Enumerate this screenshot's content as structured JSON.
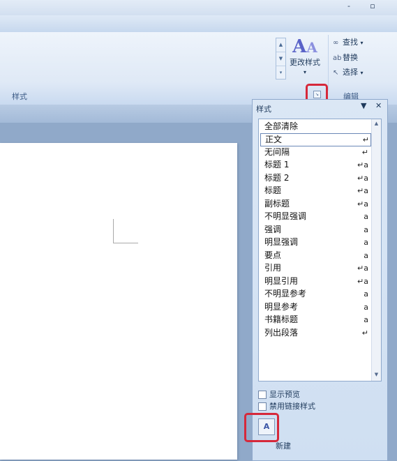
{
  "window": {
    "minimize_glyph": "-",
    "restore_glyph": "▫"
  },
  "ribbon": {
    "styles_group_label": "样式",
    "editing_group_label": "编辑",
    "change_styles_label": "更改样式",
    "change_styles_arrow": "▾",
    "find_label": "查找",
    "replace_label": "替换",
    "select_label": "选择",
    "launcher_icon": "dialog-launcher-icon",
    "scroll_glyphs": [
      "▲",
      "▼",
      "▾"
    ]
  },
  "styles_pane": {
    "title": "样式",
    "menu_glyph": "▼",
    "close_glyph": "✕",
    "items": [
      {
        "label": "全部清除",
        "symbol": ""
      },
      {
        "label": "正文",
        "symbol": "↵"
      },
      {
        "label": "无间隔",
        "symbol": "↵"
      },
      {
        "label": "标题 1",
        "symbol": "↵a"
      },
      {
        "label": "标题 2",
        "symbol": "↵a"
      },
      {
        "label": "标题",
        "symbol": "↵a"
      },
      {
        "label": "副标题",
        "symbol": "↵a"
      },
      {
        "label": "不明显强调",
        "symbol": "a"
      },
      {
        "label": "强调",
        "symbol": "a"
      },
      {
        "label": "明显强调",
        "symbol": "a"
      },
      {
        "label": "要点",
        "symbol": "a"
      },
      {
        "label": "引用",
        "symbol": "↵a"
      },
      {
        "label": "明显引用",
        "symbol": "↵a"
      },
      {
        "label": "不明显参考",
        "symbol": "a"
      },
      {
        "label": "明显参考",
        "symbol": "a"
      },
      {
        "label": "书籍标题",
        "symbol": "a"
      },
      {
        "label": "列出段落",
        "symbol": "↵"
      }
    ],
    "selected_item": "正文",
    "show_preview_label": "显示预览",
    "disable_linked_label": "禁用链接样式",
    "new_style_label": "新建"
  },
  "colors": {
    "highlight": "#d6283a",
    "accent": "#1e395b"
  }
}
